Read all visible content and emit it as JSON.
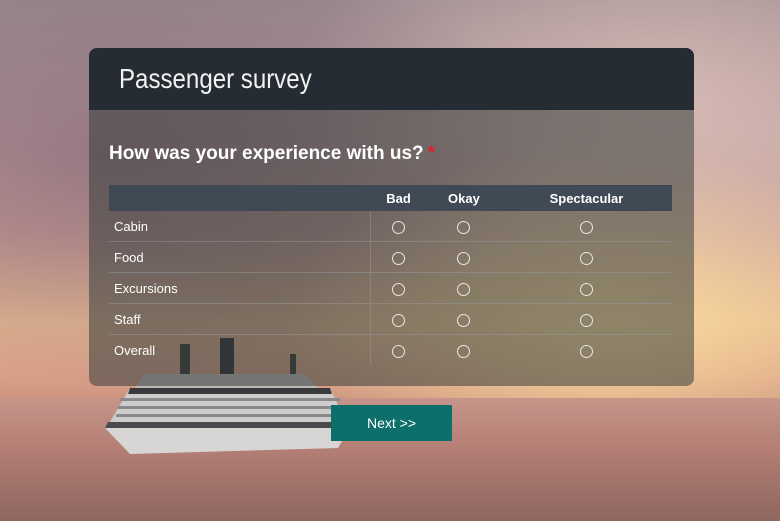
{
  "survey": {
    "title": "Passenger survey",
    "question": "How was your experience with us?",
    "required_mark": "*",
    "columns": [
      "Bad",
      "Okay",
      "Spectacular"
    ],
    "rows": [
      "Cabin",
      "Food",
      "Excursions",
      "Staff",
      "Overall"
    ]
  },
  "actions": {
    "next_label": "Next >>"
  }
}
